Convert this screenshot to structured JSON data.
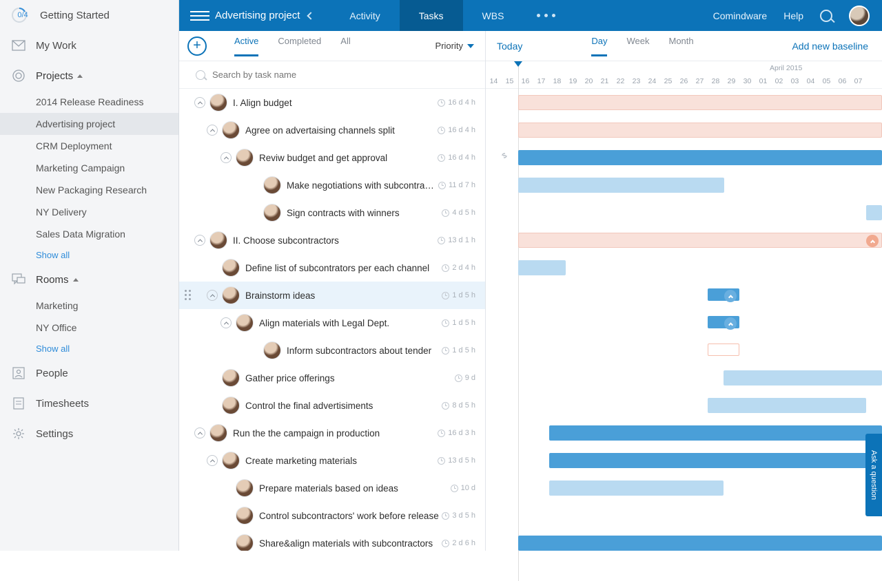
{
  "sidebar": {
    "progress": "0/4",
    "getting_started": "Getting Started",
    "my_work": "My Work",
    "projects_label": "Projects",
    "projects": [
      "2014 Release Readiness",
      "Advertising project",
      "CRM Deployment",
      "Marketing Campaign",
      "New Packaging Research",
      "NY Delivery",
      "Sales Data Migration"
    ],
    "show_all": "Show all",
    "rooms_label": "Rooms",
    "rooms": [
      "Marketing",
      "NY Office"
    ],
    "people": "People",
    "timesheets": "Timesheets",
    "settings": "Settings"
  },
  "topbar": {
    "title": "Advertising project",
    "tabs": [
      "Activity",
      "Tasks",
      "WBS"
    ],
    "brand": "Comindware",
    "help": "Help"
  },
  "tasklist": {
    "filters": [
      "Active",
      "Completed",
      "All"
    ],
    "priority": "Priority",
    "search_placeholder": "Search by task name",
    "items": [
      {
        "lv": 0,
        "collapse": true,
        "title": "I. Align budget",
        "dur": "16 d 4 h"
      },
      {
        "lv": 1,
        "collapse": true,
        "title": "Agree on advertaising channels split",
        "dur": "16 d 4 h"
      },
      {
        "lv": 2,
        "collapse": true,
        "title": "Reviw budget and get approval",
        "dur": "16 d 4 h"
      },
      {
        "lv": 3,
        "collapse": false,
        "title": "Make negotiations with subcontractors",
        "dur": "11 d 7 h"
      },
      {
        "lv": 3,
        "collapse": false,
        "title": "Sign contracts with winners",
        "dur": "4 d 5 h"
      },
      {
        "lv": 0,
        "collapse": true,
        "title": "II. Choose subcontractors",
        "dur": "13 d 1 h"
      },
      {
        "lv": 1,
        "collapse": false,
        "title": "Define list of subcontrators per each channel",
        "dur": "2 d 4 h"
      },
      {
        "lv": 1,
        "collapse": true,
        "title": "Brainstorm ideas",
        "dur": "1 d 5 h",
        "highlight": true
      },
      {
        "lv": 2,
        "collapse": true,
        "title": "Align materials with Legal Dept.",
        "dur": "1 d 5 h"
      },
      {
        "lv": 3,
        "collapse": false,
        "title": "Inform subcontractors about tender",
        "dur": "1 d 5 h"
      },
      {
        "lv": 1,
        "collapse": false,
        "title": "Gather price offerings",
        "dur": "9 d"
      },
      {
        "lv": 1,
        "collapse": false,
        "title": "Control the final advertisiments",
        "dur": "8 d 5 h"
      },
      {
        "lv": 0,
        "collapse": true,
        "title": "Run the the campaign in production",
        "dur": "16 d 3 h"
      },
      {
        "lv": 1,
        "collapse": true,
        "title": "Create marketing materials",
        "dur": "13 d 5 h"
      },
      {
        "lv": 2,
        "collapse": false,
        "title": "Prepare materials based on ideas",
        "dur": "10 d"
      },
      {
        "lv": 2,
        "collapse": false,
        "title": "Control subcontractors' work before release",
        "dur": "3 d 5 h"
      },
      {
        "lv": 2,
        "collapse": false,
        "title": "Share&align materials with subcontractors",
        "dur": "2 d 6 h"
      }
    ]
  },
  "gantt": {
    "today": "Today",
    "scales": [
      "Day",
      "Week",
      "Month"
    ],
    "baseline": "Add new baseline",
    "month": "April 2015",
    "days": [
      "14",
      "15",
      "16",
      "17",
      "18",
      "19",
      "20",
      "21",
      "22",
      "23",
      "24",
      "25",
      "26",
      "27",
      "28",
      "29",
      "30",
      "01",
      "02",
      "03",
      "04",
      "05",
      "06",
      "07"
    ]
  },
  "ask": "Ask a question"
}
